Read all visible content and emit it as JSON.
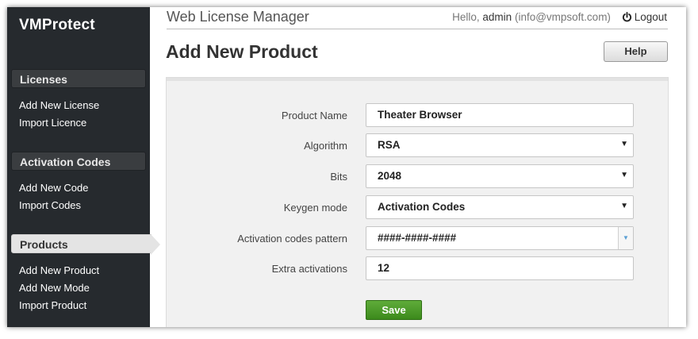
{
  "brand": "VMProtect",
  "header": {
    "app_title": "Web License Manager",
    "greeting": "Hello, ",
    "user_name": "admin",
    "user_email": "(info@vmpsoft.com)",
    "logout_label": "Logout"
  },
  "page": {
    "title": "Add New Product",
    "help_label": "Help"
  },
  "sidebar": {
    "sections": [
      {
        "title": "Licenses",
        "items": [
          "Add New License",
          "Import Licence"
        ]
      },
      {
        "title": "Activation Codes",
        "items": [
          "Add New Code",
          "Import Codes"
        ]
      },
      {
        "title": "Products",
        "items": [
          "Add New Product",
          "Add New Mode",
          "Import Product"
        ],
        "active": true
      }
    ]
  },
  "form": {
    "product_name": {
      "label": "Product Name",
      "value": "Theater Browser"
    },
    "algorithm": {
      "label": "Algorithm",
      "value": "RSA"
    },
    "bits": {
      "label": "Bits",
      "value": "2048"
    },
    "keygen_mode": {
      "label": "Keygen mode",
      "value": "Activation Codes"
    },
    "activation_pattern": {
      "label": "Activation codes pattern",
      "value": "####-####-####"
    },
    "extra_activations": {
      "label": "Extra activations",
      "value": "12"
    },
    "save_label": "Save"
  },
  "colors": {
    "sidebar_bg": "#262a2e",
    "save_green": "#4a9a29",
    "dropdown_accent": "#5a9fd4"
  }
}
